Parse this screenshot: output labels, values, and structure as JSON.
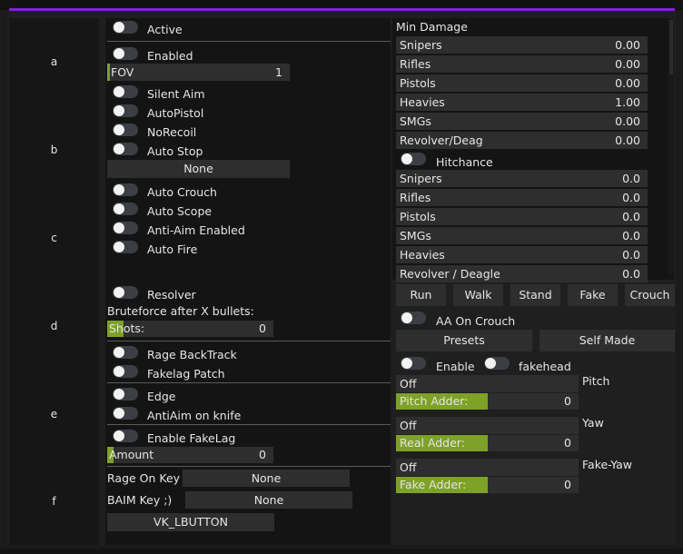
{
  "tabs": [
    "a",
    "b",
    "c",
    "d",
    "e",
    "f"
  ],
  "left": {
    "active": "Active",
    "enabled": "Enabled",
    "fov_label": "FOV",
    "fov_value": "1",
    "silent_aim": "Silent Aim",
    "auto_pistol": "AutoPistol",
    "no_recoil": "NoRecoil",
    "auto_stop": "Auto Stop",
    "stop_mode": "None",
    "auto_crouch": "Auto Crouch",
    "auto_scope": "Auto Scope",
    "anti_aim": "Anti-Aim Enabled",
    "auto_fire": "Auto Fire",
    "resolver": "Resolver",
    "bruteforce": "Bruteforce after X bullets:",
    "shots_label": "Shots:",
    "shots_value": "0",
    "shots_fill": 0.1,
    "rage_backtrack": "Rage BackTrack",
    "fakelag_patch": "Fakelag Patch",
    "edge": "Edge",
    "antiaim_knife": "AntiAim on knife",
    "enable_fakelag": "Enable FakeLag",
    "amount_label": "Amount",
    "amount_value": "0",
    "amount_fill": 0.04,
    "rage_key_label": "Rage On Key",
    "rage_key_value": "None",
    "baim_key_label": "BAIM Key ;)",
    "baim_key_value": "None",
    "key_button": "VK_LBUTTON"
  },
  "right": {
    "min_damage": "Min Damage",
    "damage": [
      {
        "label": "Snipers",
        "value": "0.00"
      },
      {
        "label": "Rifles",
        "value": "0.00"
      },
      {
        "label": "Pistols",
        "value": "0.00"
      },
      {
        "label": "Heavies",
        "value": "1.00"
      },
      {
        "label": "SMGs",
        "value": "0.00"
      },
      {
        "label": "Revolver/Deag",
        "value": "0.00"
      }
    ],
    "hitchance": "Hitchance",
    "hit": [
      {
        "label": "Snipers",
        "value": "0.0"
      },
      {
        "label": "Rifles",
        "value": "0.0"
      },
      {
        "label": "Pistols",
        "value": "0.0"
      },
      {
        "label": "SMGs",
        "value": "0.0"
      },
      {
        "label": "Heavies",
        "value": "0.0"
      },
      {
        "label": "Revolver / Deagle",
        "value": "0.0"
      }
    ],
    "modes": [
      "Run",
      "Walk",
      "Stand",
      "Fake",
      "Crouch"
    ],
    "aa_on_crouch": "AA On Crouch",
    "presets": "Presets",
    "self_made": "Self Made",
    "enable": "Enable",
    "fakehead": "fakehead",
    "pitch_value": "Off",
    "pitch": "Pitch",
    "pitch_adder_label": "Pitch Adder:",
    "pitch_adder_value": "0",
    "yaw_value": "Off",
    "yaw": "Yaw",
    "real_adder_label": "Real Adder:",
    "real_adder_value": "0",
    "fakeyaw_value": "Off",
    "fakeyaw": "Fake-Yaw",
    "fake_adder_label": "Fake Adder:",
    "fake_adder_value": "0"
  },
  "colors": {
    "accent": "#8a1ce0",
    "slider_fill": "#7ea128",
    "toggle_off": "#3b3e45"
  }
}
